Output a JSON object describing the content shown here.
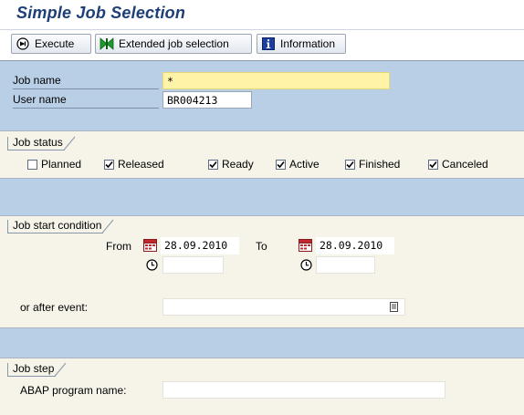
{
  "title": "Simple Job Selection",
  "toolbar": {
    "execute_label": "Execute",
    "extended_label": "Extended job selection",
    "information_label": "Information"
  },
  "fields": {
    "job_name_label": "Job name",
    "job_name_value": "*",
    "user_name_label": "User name",
    "user_name_value": "BR004213"
  },
  "job_status": {
    "title": "Job status",
    "options": [
      {
        "label": "Planned",
        "checked": false
      },
      {
        "label": "Released",
        "checked": true
      },
      {
        "label": "Ready",
        "checked": true
      },
      {
        "label": "Active",
        "checked": true
      },
      {
        "label": "Finished",
        "checked": true
      },
      {
        "label": "Canceled",
        "checked": true
      }
    ]
  },
  "job_start": {
    "title": "Job start condition",
    "from_label": "From",
    "from_date": "28.09.2010",
    "from_time": "",
    "to_label": "To",
    "to_date": "28.09.2010",
    "to_time": "",
    "after_event_label": "or after event:",
    "after_event_value": ""
  },
  "job_step": {
    "title": "Job step",
    "abap_label": "ABAP program name:",
    "abap_value": ""
  },
  "colors": {
    "title": "#1d3f78",
    "strip": "#b8cfe6",
    "group_bg": "#f6f4e9",
    "required_field": "#fff3a8",
    "calendar_icon": "#c0282d",
    "extended_icon": "#1e9a2c",
    "info_icon": "#1a3fa0"
  },
  "icons": [
    "execute-icon",
    "extended-selection-icon",
    "information-icon",
    "calendar-icon",
    "clock-icon",
    "search-help-icon",
    "checkmark-icon"
  ]
}
